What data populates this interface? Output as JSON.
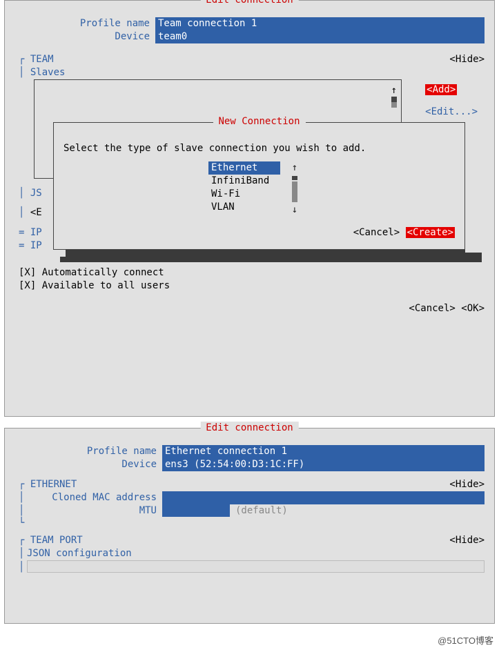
{
  "window1": {
    "title": "Edit connection",
    "profile_label": "Profile name",
    "profile_value": "Team connection 1",
    "device_label": "Device",
    "device_value": "team0",
    "team_label": "TEAM",
    "slaves_label": "Slaves",
    "hide_label": "<Hide>",
    "add_label": "<Add>",
    "edit_label": "<Edit...>",
    "js_label": "JS",
    "e_label": "<E",
    "ip1_label": "= IP",
    "ip2_label": "= IP",
    "auto_label": "[X] Automatically connect",
    "avail_label": "[X] Available to all users",
    "cancel_label": "<Cancel>",
    "ok_label": "<OK>"
  },
  "dialog": {
    "title": "New Connection",
    "prompt": "Select the type of slave connection you wish to add.",
    "options": [
      "Ethernet",
      "InfiniBand",
      "Wi-Fi",
      "VLAN"
    ],
    "cancel_label": "<Cancel>",
    "create_label": "<Create>"
  },
  "window2": {
    "title": "Edit connection",
    "profile_label": "Profile name",
    "profile_value": "Ethernet connection 1",
    "device_label": "Device",
    "device_value": "ens3 (52:54:00:D3:1C:FF)",
    "eth_label": "ETHERNET",
    "mac_label": "Cloned MAC address",
    "mtu_label": "MTU",
    "mtu_hint": "(default)",
    "hide_label": "<Hide>",
    "teamport_label": "TEAM PORT",
    "json_label": "JSON configuration"
  },
  "watermark": "@51CTO博客"
}
